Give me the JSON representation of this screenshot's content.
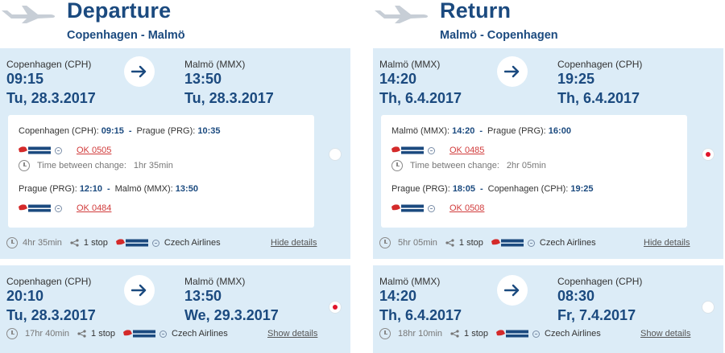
{
  "departure": {
    "title": "Departure",
    "route": "Copenhagen - Malmö",
    "options": [
      {
        "from_city": "Copenhagen (CPH)",
        "from_time": "09:15",
        "from_date": "Tu, 28.3.2017",
        "to_city": "Malmö (MMX)",
        "to_time": "13:50",
        "to_date": "Tu, 28.3.2017",
        "selected": false,
        "segments": [
          {
            "from_city": "Copenhagen (CPH):",
            "from_time": "09:15",
            "to_city": "Prague (PRG):",
            "to_time": "10:35",
            "flight": "OK 0505"
          },
          {
            "from_city": "Prague (PRG):",
            "from_time": "12:10",
            "to_city": "Malmö (MMX):",
            "to_time": "13:50",
            "flight": "OK 0484"
          }
        ],
        "change_label": "Time between change:",
        "change_value": "1hr 35min",
        "duration": "4hr 35min",
        "stops": "1 stop",
        "airline": "Czech Airlines",
        "toggle": "Hide details"
      },
      {
        "from_city": "Copenhagen (CPH)",
        "from_time": "20:10",
        "from_date": "Tu, 28.3.2017",
        "to_city": "Malmö (MMX)",
        "to_time": "13:50",
        "to_date": "We, 29.3.2017",
        "selected": true,
        "duration": "17hr 40min",
        "stops": "1 stop",
        "airline": "Czech Airlines",
        "toggle": "Show details"
      }
    ]
  },
  "return": {
    "title": "Return",
    "route": "Malmö - Copenhagen",
    "options": [
      {
        "from_city": "Malmö (MMX)",
        "from_time": "14:20",
        "from_date": "Th, 6.4.2017",
        "to_city": "Copenhagen (CPH)",
        "to_time": "19:25",
        "to_date": "Th, 6.4.2017",
        "selected": true,
        "segments": [
          {
            "from_city": "Malmö (MMX):",
            "from_time": "14:20",
            "to_city": "Prague (PRG):",
            "to_time": "16:00",
            "flight": "OK 0485"
          },
          {
            "from_city": "Prague (PRG):",
            "from_time": "18:05",
            "to_city": "Copenhagen (CPH):",
            "to_time": "19:25",
            "flight": "OK 0508"
          }
        ],
        "change_label": "Time between change:",
        "change_value": "2hr 05min",
        "duration": "5hr 05min",
        "stops": "1 stop",
        "airline": "Czech Airlines",
        "toggle": "Hide details"
      },
      {
        "from_city": "Malmö (MMX)",
        "from_time": "14:20",
        "from_date": "Th, 6.4.2017",
        "to_city": "Copenhagen (CPH)",
        "to_time": "08:30",
        "to_date": "Fr, 7.4.2017",
        "selected": false,
        "duration": "18hr 10min",
        "stops": "1 stop",
        "airline": "Czech Airlines",
        "toggle": "Show details"
      }
    ]
  },
  "icons": {
    "plane": "plane-icon",
    "arrow": "arrow-right-icon",
    "clock": "clock-icon",
    "share": "share-icon",
    "airline_logo": "czech-airlines-logo",
    "globe": "globe-icon"
  },
  "colors": {
    "brand_blue": "#1b4a7f",
    "card_bg": "#dcecf7",
    "link_red": "#d13b3b",
    "radio_selected": "#e0142a"
  }
}
